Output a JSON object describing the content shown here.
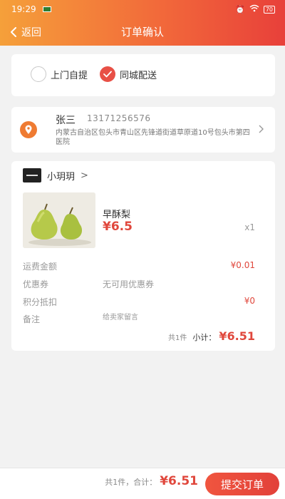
{
  "status_bar": {
    "time": "19:29",
    "battery": "70"
  },
  "nav": {
    "back_label": "返回",
    "title": "订单确认"
  },
  "delivery": {
    "options": [
      {
        "label": "上门自提",
        "selected": false
      },
      {
        "label": "同城配送",
        "selected": true
      }
    ]
  },
  "address": {
    "name": "张三",
    "phone": "13171256576",
    "detail": "内蒙古自治区包头市青山区先锋道街道草原道10号包头市第四医院"
  },
  "shop": {
    "name": "小玥玥",
    "arrow": ">"
  },
  "product": {
    "name": "早酥梨",
    "price": "¥6.5",
    "quantity": "x1"
  },
  "rows": {
    "shipping": {
      "label": "运费金额",
      "value": "¥0.01"
    },
    "coupon": {
      "label": "优惠券",
      "value": "无可用优惠券"
    },
    "points": {
      "label": "积分抵扣",
      "value": "¥0"
    },
    "remark": {
      "label": "备注",
      "placeholder": "给卖家留言"
    }
  },
  "subtotal": {
    "count": "共1件",
    "label": "小计：",
    "amount": "¥6.51"
  },
  "footer": {
    "total_label": "共1件，合计：",
    "total_amount": "¥6.51",
    "submit_label": "提交订单"
  },
  "colors": {
    "header_gradient_start": "#f5a03a",
    "header_gradient_end": "#e8403a",
    "accent_red": "#e0473c",
    "pin_orange": "#ef7b32"
  },
  "icons": {
    "back": "chevron-left-icon",
    "location": "location-pin-icon",
    "address_arrow": "chevron-right-icon",
    "check": "check-icon",
    "shop_logo": "shop-logo",
    "status_app": "app-notification-icon",
    "alarm": "alarm-icon",
    "wifi": "wifi-icon",
    "battery": "battery-icon"
  }
}
